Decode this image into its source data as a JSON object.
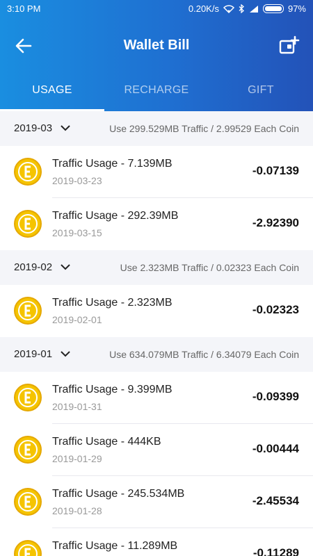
{
  "status": {
    "time": "3:10 PM",
    "speed": "0.20K/s",
    "battery": "97%"
  },
  "header": {
    "title": "Wallet Bill"
  },
  "tabs": [
    {
      "label": "USAGE",
      "active": true
    },
    {
      "label": "RECHARGE",
      "active": false
    },
    {
      "label": "GIFT",
      "active": false
    }
  ],
  "months": [
    {
      "label": "2019-03",
      "summary": "Use 299.529MB Traffic / 2.99529 Each Coin",
      "items": [
        {
          "title": "Traffic Usage - 7.139MB",
          "date": "2019-03-23",
          "amount": "-0.07139"
        },
        {
          "title": "Traffic Usage - 292.39MB",
          "date": "2019-03-15",
          "amount": "-2.92390"
        }
      ]
    },
    {
      "label": "2019-02",
      "summary": "Use 2.323MB Traffic / 0.02323 Each Coin",
      "items": [
        {
          "title": "Traffic Usage - 2.323MB",
          "date": "2019-02-01",
          "amount": "-0.02323"
        }
      ]
    },
    {
      "label": "2019-01",
      "summary": "Use 634.079MB Traffic / 6.34079 Each Coin",
      "items": [
        {
          "title": "Traffic Usage - 9.399MB",
          "date": "2019-01-31",
          "amount": "-0.09399"
        },
        {
          "title": "Traffic Usage - 444KB",
          "date": "2019-01-29",
          "amount": "-0.00444"
        },
        {
          "title": "Traffic Usage - 245.534MB",
          "date": "2019-01-28",
          "amount": "-2.45534"
        },
        {
          "title": "Traffic Usage - 11.289MB",
          "date": "",
          "amount": "-0.11289"
        }
      ]
    }
  ],
  "colors": {
    "header_start": "#1a8ee0",
    "header_end": "#2352b8",
    "coin": "#f5c400",
    "coin_edge": "#e5a800"
  },
  "icons": {
    "back": "arrow-left-icon",
    "add": "add-card-icon",
    "coin": "coin-icon",
    "dropdown": "chevron-down-icon"
  }
}
